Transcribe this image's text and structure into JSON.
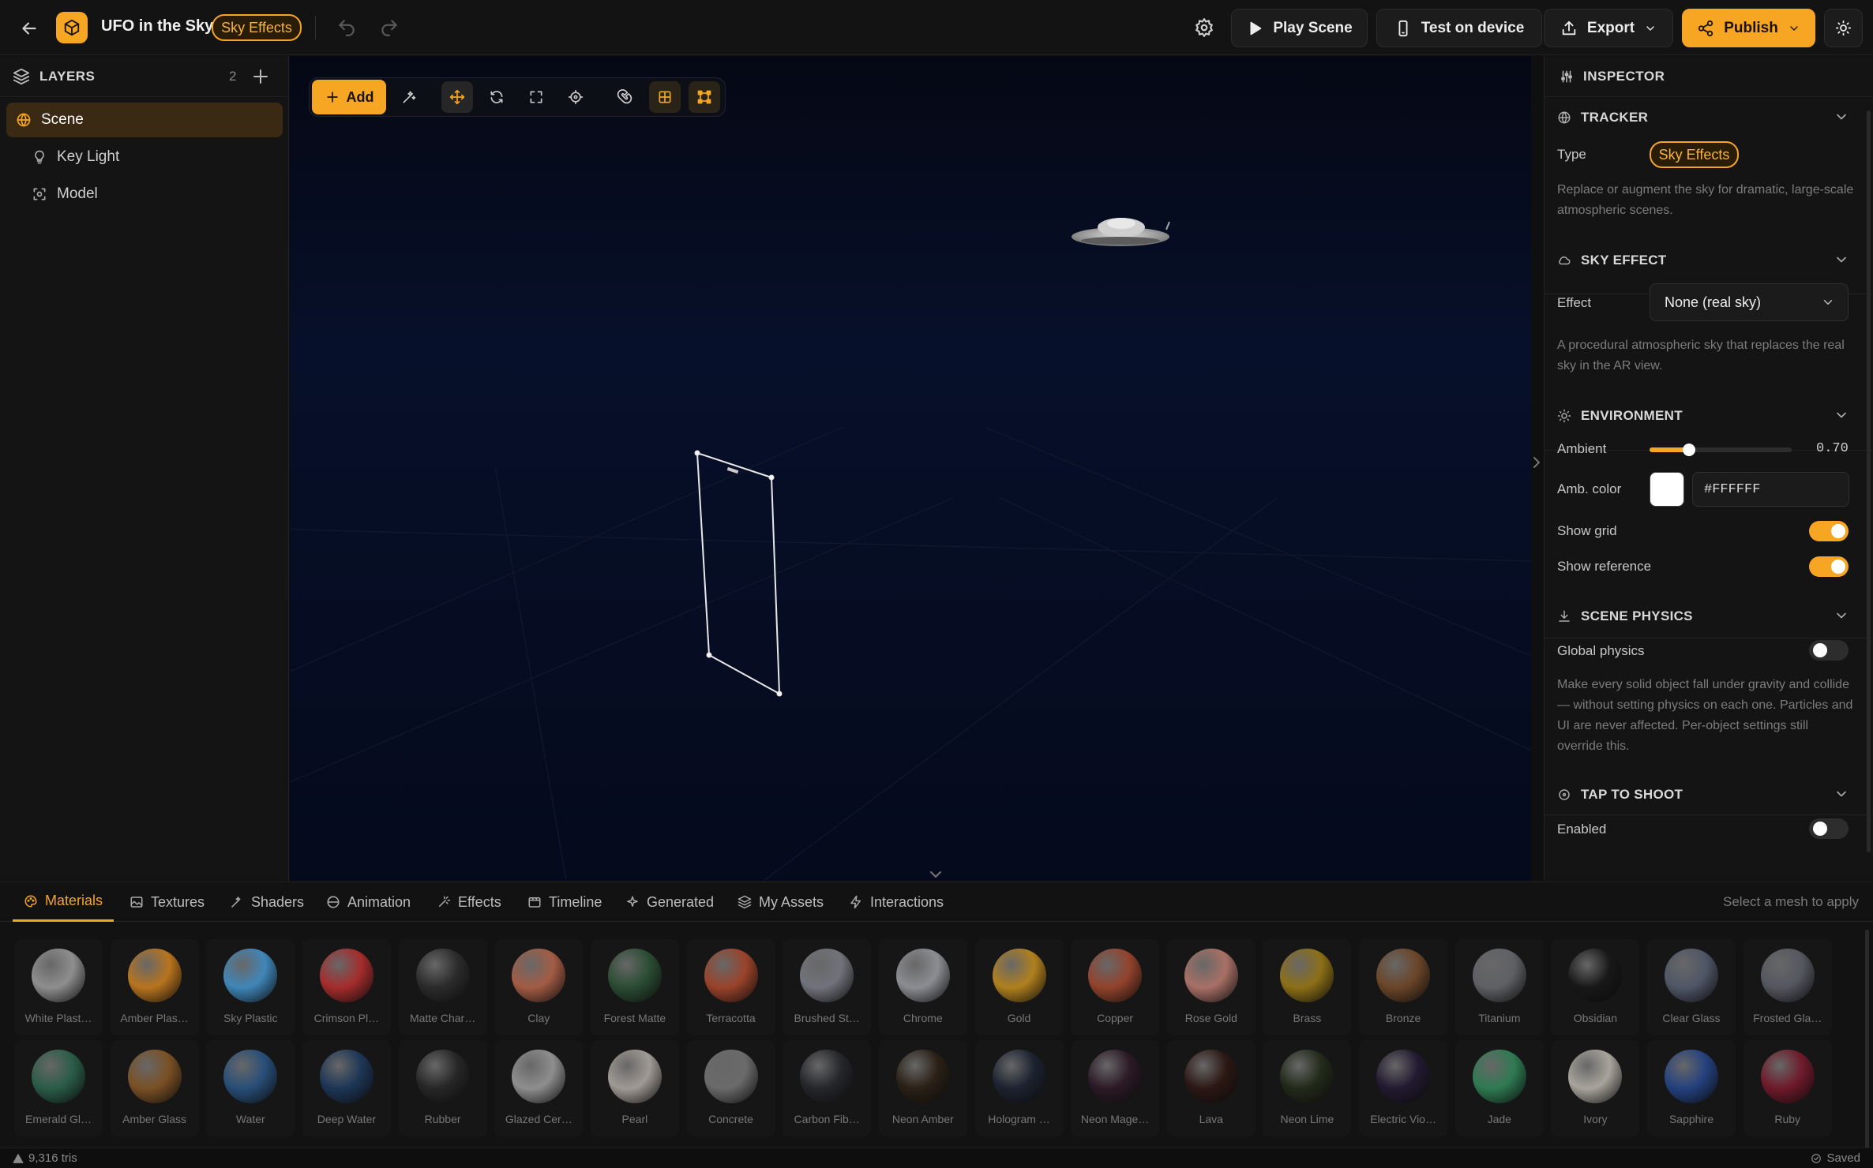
{
  "header": {
    "title": "UFO in the Sky",
    "badge": "Sky Effects",
    "play": "Play Scene",
    "test": "Test on device",
    "export": "Export",
    "publish": "Publish"
  },
  "layers": {
    "title": "LAYERS",
    "count": "2",
    "items": [
      "Scene",
      "Key Light",
      "Model"
    ]
  },
  "viewport": {
    "add_label": "Add"
  },
  "inspector": {
    "title": "INSPECTOR",
    "tracker": {
      "title": "TRACKER",
      "type_label": "Type",
      "type_value": "Sky Effects",
      "desc": "Replace or augment the sky for dramatic, large-scale atmospheric scenes."
    },
    "sky": {
      "title": "SKY EFFECT",
      "effect_label": "Effect",
      "effect_value": "None (real sky)",
      "desc": "A procedural atmospheric sky that replaces the real sky in the AR view."
    },
    "env": {
      "title": "ENVIRONMENT",
      "ambient_label": "Ambient",
      "ambient_value": "0.70",
      "ambient_level": 0.7,
      "color_label": "Amb. color",
      "color_value": "#FFFFFF",
      "grid_label": "Show grid",
      "ref_label": "Show reference"
    },
    "physics": {
      "title": "SCENE PHYSICS",
      "global_label": "Global physics",
      "desc": "Make every solid object fall under gravity and collide — without setting physics on each one. Particles and UI are never affected. Per-object settings still override this."
    },
    "tap": {
      "title": "TAP TO SHOOT",
      "enabled_label": "Enabled"
    }
  },
  "bottom": {
    "tabs": [
      "Materials",
      "Textures",
      "Shaders",
      "Animation",
      "Effects",
      "Timeline",
      "Generated",
      "My Assets",
      "Interactions"
    ],
    "hint": "Select a mesh to apply",
    "materials_row1": [
      {
        "name": "White Plast…",
        "color": "#8e8e8e"
      },
      {
        "name": "Amber Plas…",
        "color": "#b8741e"
      },
      {
        "name": "Sky Plastic",
        "color": "#3f86b8"
      },
      {
        "name": "Crimson Pl…",
        "color": "#a52c2c"
      },
      {
        "name": "Matte Char…",
        "color": "#2b2b2b"
      },
      {
        "name": "Clay",
        "color": "#a35c44"
      },
      {
        "name": "Forest Matte",
        "color": "#2a4c33"
      },
      {
        "name": "Terracotta",
        "color": "#9a432a"
      },
      {
        "name": "Brushed St…",
        "color": "#71737a"
      },
      {
        "name": "Chrome",
        "color": "#8c8d92"
      },
      {
        "name": "Gold",
        "color": "#b0801e"
      },
      {
        "name": "Copper",
        "color": "#92432c"
      },
      {
        "name": "Rose Gold",
        "color": "#a87066"
      },
      {
        "name": "Brass",
        "color": "#8c6f16"
      },
      {
        "name": "Bronze",
        "color": "#6a4528"
      },
      {
        "name": "Titanium",
        "color": "#5f6064"
      },
      {
        "name": "Obsidian",
        "color": "#181818"
      },
      {
        "name": "Clear Glass",
        "color": "#4f5666"
      },
      {
        "name": "Frosted Gla…",
        "color": "#55575f"
      }
    ],
    "materials_row2": [
      {
        "name": "Emerald Gl…",
        "color": "#2a5c48"
      },
      {
        "name": "Amber Glass",
        "color": "#7a5024"
      },
      {
        "name": "Water",
        "color": "#284e78"
      },
      {
        "name": "Deep Water",
        "color": "#1d3656"
      },
      {
        "name": "Rubber",
        "color": "#262626"
      },
      {
        "name": "Glazed Cer…",
        "color": "#8e8e8e"
      },
      {
        "name": "Pearl",
        "color": "#a09a94"
      },
      {
        "name": "Concrete",
        "color": "#6a6a6a"
      },
      {
        "name": "Carbon Fib…",
        "color": "#25262a"
      },
      {
        "name": "Neon Amber",
        "color": "#2a2016"
      },
      {
        "name": "Hologram …",
        "color": "#1c2230"
      },
      {
        "name": "Neon Mage…",
        "color": "#2c1a26"
      },
      {
        "name": "Lava",
        "color": "#2c1814"
      },
      {
        "name": "Neon Lime",
        "color": "#222a1a"
      },
      {
        "name": "Electric Vio…",
        "color": "#221a30"
      },
      {
        "name": "Jade",
        "color": "#2e7a52"
      },
      {
        "name": "Ivory",
        "color": "#a8a49c"
      },
      {
        "name": "Sapphire",
        "color": "#24417e"
      },
      {
        "name": "Ruby",
        "color": "#6e1a2a"
      }
    ]
  },
  "status": {
    "tris": "9,316 tris",
    "saved": "Saved"
  },
  "colors": {
    "accent": "#f6a623",
    "viewport": "#050a1a"
  }
}
